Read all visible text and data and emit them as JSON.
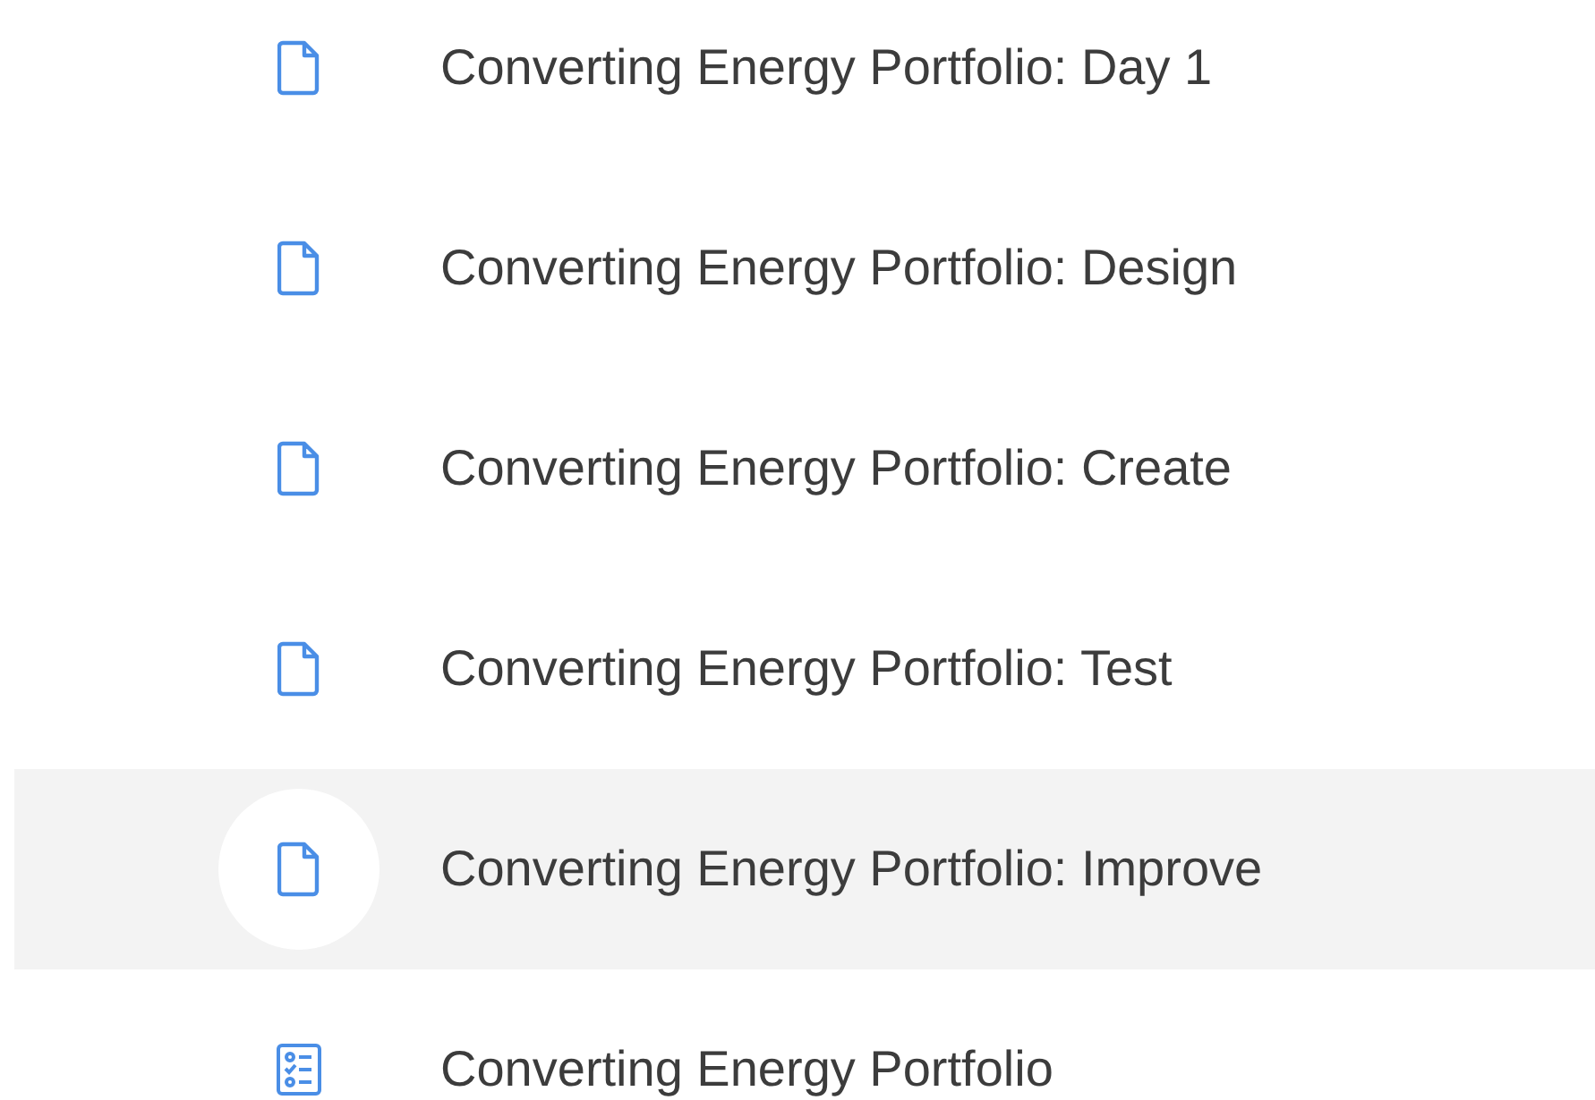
{
  "items": [
    {
      "kind": "material",
      "title": "Converting Energy Portfolio: Day 1",
      "selected": false
    },
    {
      "kind": "material",
      "title": "Converting Energy Portfolio: Design",
      "selected": false
    },
    {
      "kind": "material",
      "title": "Converting Energy Portfolio: Create",
      "selected": false
    },
    {
      "kind": "material",
      "title": "Converting Energy Portfolio: Test",
      "selected": false
    },
    {
      "kind": "material",
      "title": "Converting Energy Portfolio: Improve",
      "selected": true
    },
    {
      "kind": "assignment",
      "title": "Converting Energy Portfolio",
      "selected": false
    }
  ]
}
